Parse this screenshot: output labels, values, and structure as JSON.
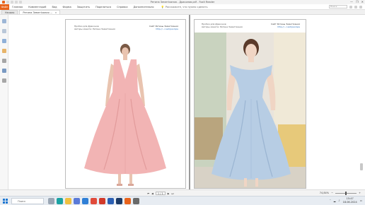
{
  "window": {
    "title": "Ретина Земетіхания - Драконов.pdf - Foxit Reader",
    "controls": [
      "—",
      "❐",
      "✕"
    ]
  },
  "ribbon": {
    "file_label": "Файл",
    "tabs": [
      "Главная",
      "Комментарий",
      "Вид",
      "Форма",
      "Защитить",
      "Поделиться",
      "Справка",
      "Дополнительно"
    ],
    "tell_me": "Расскажите, что нужно сделать",
    "search_placeholder": "Поиск"
  },
  "doc_tabs": [
    {
      "label": "Начало",
      "active": false
    },
    {
      "label": "Ретина Земетіхания ...",
      "active": true
    }
  ],
  "pages": {
    "left": {
      "header_left": [
        "Пробки для Драконов",
        "Авторы макета: Ретина Земетіхания"
      ],
      "header_right": [
        "Сайт Ретины Земетіхания",
        "http://...rusdrpaolops"
      ]
    },
    "right": {
      "header_left": [
        "Пробки для Драконов",
        "Авторы макета: Ретина Земетіхания"
      ],
      "header_right": [
        "Сайт Ретины Земетіхания",
        "http://...rusdrpaolops"
      ]
    }
  },
  "statusbar": {
    "page_indicator": "1 / 1",
    "zoom": "74,84%"
  },
  "taskbar": {
    "search_placeholder": "Поиск",
    "clock_time": "15:47",
    "clock_date": "18.06.2024"
  },
  "colors": {
    "accent": "#e8631b",
    "pink_dress": "#f2b4b4",
    "blue_dress": "#b7cde4",
    "link": "#2a6fbb"
  }
}
